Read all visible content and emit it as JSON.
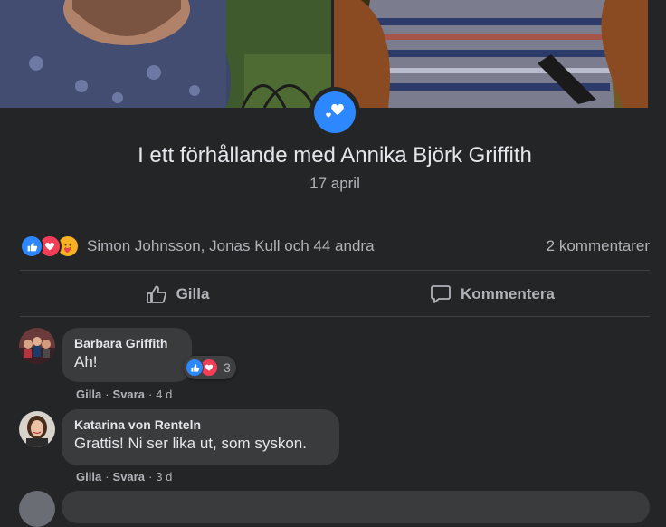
{
  "relationship": {
    "icon": "heart-icon",
    "title": "I ett förhållande med Annika Björk Griffith",
    "date": "17 april"
  },
  "reactions": {
    "types": [
      "like-icon",
      "love-icon",
      "care-icon"
    ],
    "names": "Simon Johnsson, Jonas Kull och 44 andra",
    "comment_count": "2 kommentarer"
  },
  "actions": {
    "like_label": "Gilla",
    "comment_label": "Kommentera"
  },
  "comments": [
    {
      "author": "Barbara Griffith",
      "text": "Ah!",
      "reaction_count": "3",
      "like": "Gilla",
      "reply": "Svara",
      "time": "4 d"
    },
    {
      "author": "Katarina von Renteln",
      "text": "Grattis! Ni ser lika ut, som syskon.",
      "like": "Gilla",
      "reply": "Svara",
      "time": "3 d"
    }
  ],
  "colors": {
    "background": "#242526",
    "bubble": "#3a3b3c",
    "accent": "#2d88ff",
    "love": "#f33e58",
    "care": "#f7b125"
  }
}
